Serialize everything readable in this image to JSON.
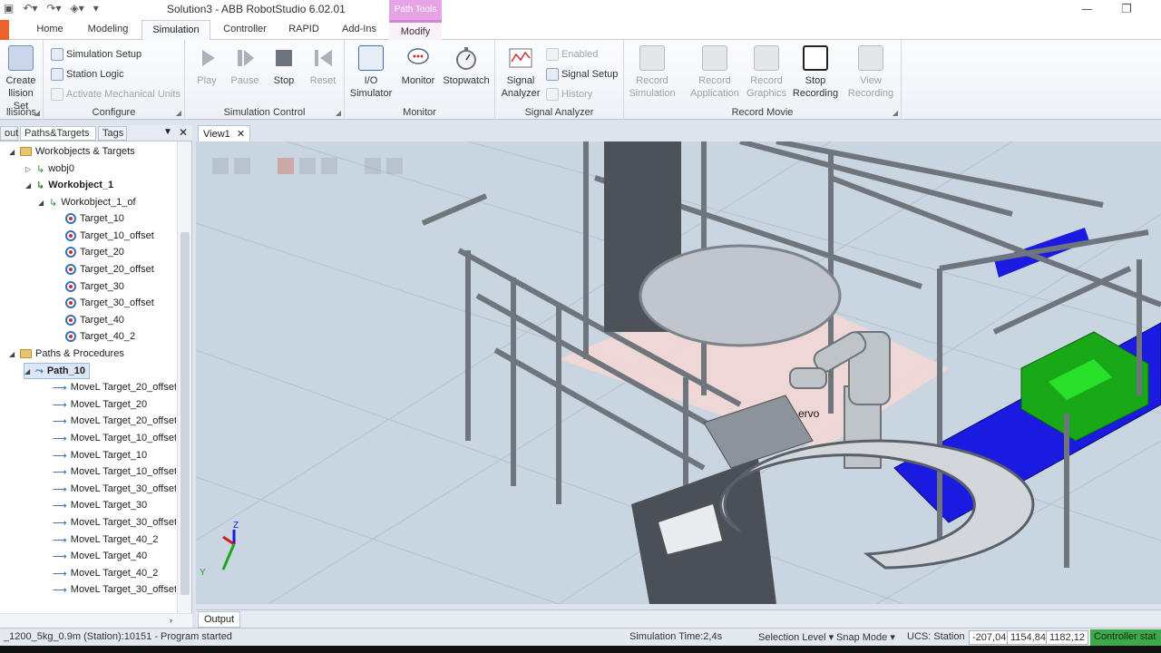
{
  "window": {
    "title": "Solution3 - ABB RobotStudio 6.02.01",
    "context_tab": "Path Tools",
    "minimize": "—",
    "restore": "❐"
  },
  "tabs": [
    "Home",
    "Modeling",
    "Simulation",
    "Controller",
    "RAPID",
    "Add-Ins",
    "Modify"
  ],
  "ribbon": {
    "collisions": {
      "create_line1": "Create",
      "create_line2": "llision Set",
      "label": "llisions"
    },
    "configure": {
      "simulation_setup": "Simulation Setup",
      "station_logic": "Station Logic",
      "activate_mechanical_units": "Activate Mechanical Units",
      "label": "Configure"
    },
    "simulation_control": {
      "play": "Play",
      "pause": "Pause",
      "stop": "Stop",
      "reset": "Reset",
      "label": "Simulation Control"
    },
    "monitor": {
      "io_line1": "I/O",
      "io_line2": "Simulator",
      "monitor": "Monitor",
      "stopwatch": "Stopwatch",
      "label": "Monitor"
    },
    "signal_analyzer": {
      "signal_line1": "Signal",
      "signal_line2": "Analyzer",
      "enabled": "Enabled",
      "signal_setup": "Signal Setup",
      "history": "History",
      "label": "Signal Analyzer"
    },
    "record_movie": {
      "rec_sim_line1": "Record",
      "rec_sim_line2": "Simulation",
      "rec_app_line1": "Record",
      "rec_app_line2": "Application",
      "rec_gfx_line1": "Record",
      "rec_gfx_line2": "Graphics",
      "stop_line1": "Stop",
      "stop_line2": "Recording",
      "view_line1": "View",
      "view_line2": "Recording",
      "label": "Record Movie"
    }
  },
  "left_panel": {
    "tabs": [
      "out",
      "Paths&Targets",
      "Tags"
    ],
    "tree": {
      "workobjects_targets": "Workobjects & Targets",
      "wobj0": "wobj0",
      "workobject_1": "Workobject_1",
      "workobject_1_of": "Workobject_1_of",
      "targets": [
        "Target_10",
        "Target_10_offset",
        "Target_20",
        "Target_20_offset",
        "Target_30",
        "Target_30_offset",
        "Target_40",
        "Target_40_2"
      ],
      "paths_procedures": "Paths & Procedures",
      "path_10": "Path_10",
      "moves": [
        "MoveL Target_20_offset",
        "MoveL Target_20",
        "MoveL Target_20_offset",
        "MoveL Target_10_offset",
        "MoveL Target_10",
        "MoveL Target_10_offset",
        "MoveL Target_30_offset",
        "MoveL Target_30",
        "MoveL Target_30_offset",
        "MoveL Target_40_2",
        "MoveL Target_40",
        "MoveL Target_40_2",
        "MoveL Target_30_offset"
      ]
    }
  },
  "view": {
    "tab": "View1",
    "servo_label": "ervo",
    "axis_z": "Z",
    "axis_y": "Y"
  },
  "output_tab": "Output",
  "status": {
    "message": "_1200_5kg_0.9m (Station):10151 - Program started",
    "sim_time": "Simulation Time:2,4s",
    "selection_level": "Selection Level ▾",
    "snap_mode": "Snap Mode ▾",
    "ucs": "UCS: Station",
    "coords": [
      "-207,04",
      "1154,84",
      "1182,12"
    ],
    "controller_status": "Controller stat"
  },
  "colors": {
    "file_tab": "#e8622a",
    "context_tab": "#e6a3e6",
    "conveyor": "#1a1ae0",
    "box": "#18a818",
    "controller_ok": "#3ea84a"
  }
}
